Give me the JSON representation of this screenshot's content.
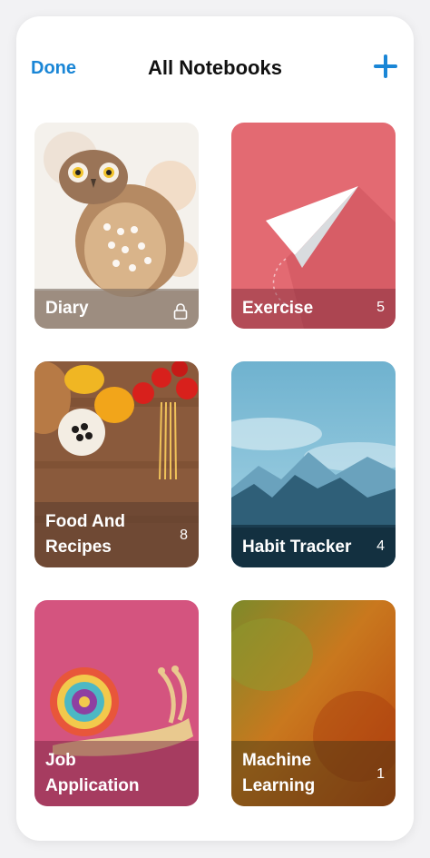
{
  "header": {
    "done_label": "Done",
    "title": "All Notebooks",
    "add_icon": "plus-icon"
  },
  "notebooks": [
    {
      "name": "Diary",
      "count": "",
      "locked": true,
      "cover": "owl"
    },
    {
      "name": "Exercise",
      "count": "5",
      "locked": false,
      "cover": "paper-plane"
    },
    {
      "name": "Food And Recipes",
      "count": "8",
      "locked": false,
      "cover": "food"
    },
    {
      "name": "Habit Tracker",
      "count": "4",
      "locked": false,
      "cover": "mountains"
    },
    {
      "name": "Job Application",
      "count": "",
      "locked": false,
      "cover": "snail"
    },
    {
      "name": "Machine Learning",
      "count": "1",
      "locked": false,
      "cover": "texture"
    }
  ],
  "colors": {
    "accent": "#1a86d6",
    "exercise_cover": "#e36a72",
    "job_cover": "#d4547f",
    "habit_sky": "#8cc7dd"
  }
}
